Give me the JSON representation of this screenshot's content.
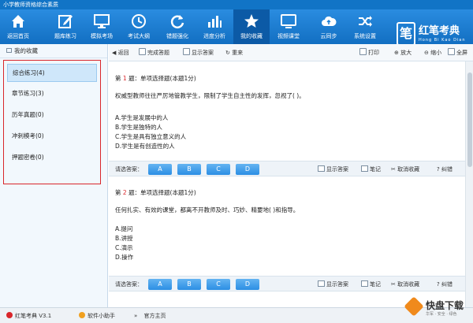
{
  "window": {
    "title": "小学教师资格综合素质"
  },
  "toolbar": {
    "items": [
      {
        "label": "返回首页",
        "icon": "home-icon"
      },
      {
        "label": "题库练习",
        "icon": "edit-icon"
      },
      {
        "label": "模拟考场",
        "icon": "monitor-icon"
      },
      {
        "label": "考试大纲",
        "icon": "clock-icon"
      },
      {
        "label": "错题强化",
        "icon": "refresh-icon"
      },
      {
        "label": "进度分析",
        "icon": "bar-chart-icon"
      },
      {
        "label": "我的收藏",
        "icon": "star-icon"
      },
      {
        "label": "视频课堂",
        "icon": "screen-icon"
      },
      {
        "label": "云同步",
        "icon": "cloud-icon"
      },
      {
        "label": "系统设置",
        "icon": "shuffle-icon"
      }
    ],
    "active_index": 6
  },
  "brand": {
    "name": "红笔考典",
    "mark": "笔",
    "sub": "Hong Bi Kao Dian"
  },
  "sidebar": {
    "header": "我的收藏",
    "items": [
      {
        "label": "综合练习(4)"
      },
      {
        "label": "章节练习(3)"
      },
      {
        "label": "历年真题(0)"
      },
      {
        "label": "冲刺模考(0)"
      },
      {
        "label": "押题密卷(0)"
      }
    ],
    "selected_index": 0
  },
  "content_toolbar": {
    "back": "返回",
    "finish": "完成答题",
    "show_answer": "显示答案",
    "redo": "重来",
    "print": "打印",
    "zoom_in": "放大",
    "zoom_out": "缩小",
    "fullscreen": "全屏"
  },
  "questions": [
    {
      "prefix": "第",
      "number": "1",
      "suffix": "题：单项选择题(本题1分)",
      "stem": "权威型教师往往严厉地管教学生，限制了学生自主性的发挥，忽视了(    )。",
      "options": [
        "A.学生是发展中的人",
        "B.学生是独特的人",
        "C.学生是具有独立意义的人",
        "D.学生是有创造性的人"
      ]
    },
    {
      "prefix": "第",
      "number": "2",
      "suffix": "题：单项选择题(本题1分)",
      "stem": "任何扎实、有效的课堂，都离不开教师及时、巧妙、精要地(    )和指导。",
      "options": [
        "A.提问",
        "B.讲授",
        "C.演示",
        "D.操作"
      ]
    }
  ],
  "answer_bar": {
    "label": "请选答案：",
    "choices": [
      "A",
      "B",
      "C",
      "D"
    ],
    "show_answer": "显示答案",
    "notes": "笔记",
    "unfavorite": "取消收藏",
    "correct": "纠错"
  },
  "statusbar": {
    "version": "红笔考典 V3.1",
    "assistant": "软件小助手",
    "homepage": "官方主页"
  },
  "watermark": {
    "text": "快盘下载",
    "sub": "华军 · 安全 · 绿色"
  }
}
